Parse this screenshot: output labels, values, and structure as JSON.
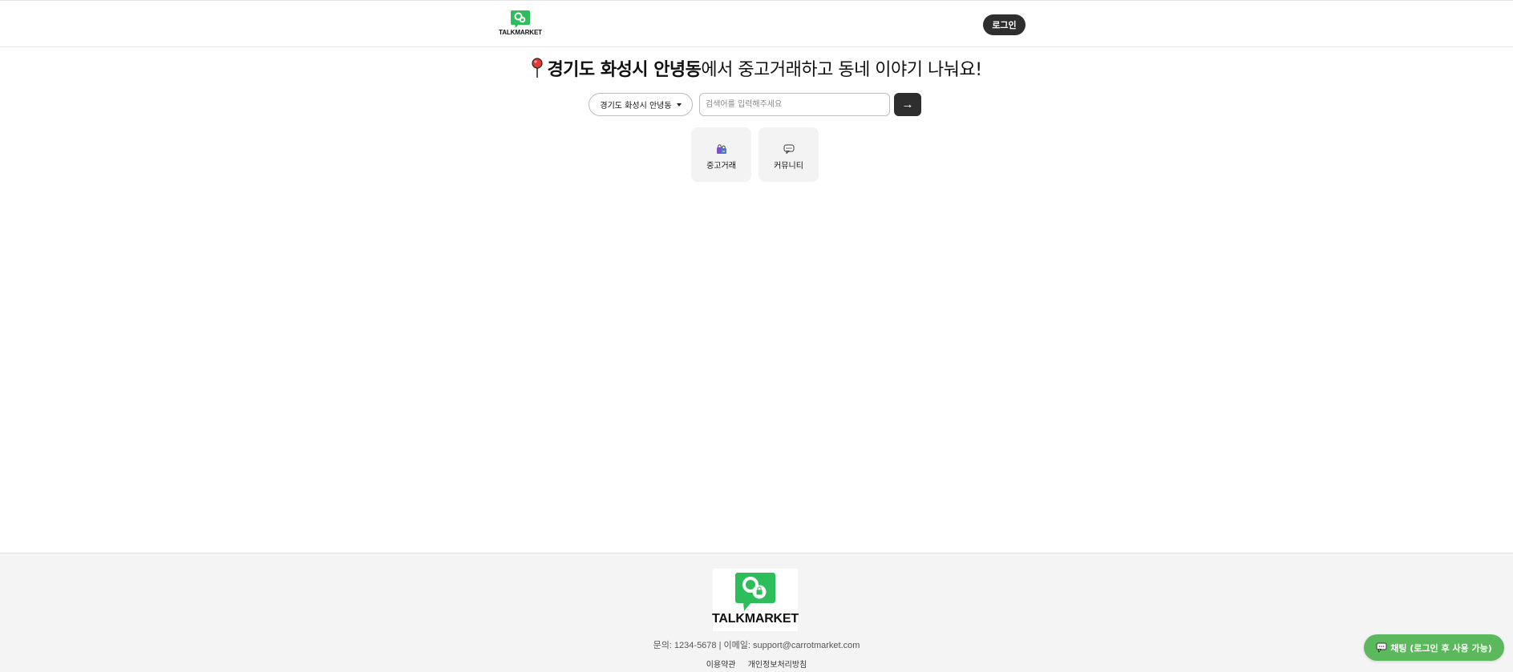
{
  "header": {
    "logo_text": "TALKMARKET",
    "login_label": "로그인"
  },
  "hero": {
    "pin_icon": "round-pushpin-icon",
    "highlight": "경기도 화성시 안녕동",
    "rest": "에서 중고거래하고 동네 이야기 나눠요!"
  },
  "search": {
    "region_value": "경기도 화성시 안녕동",
    "placeholder": "검색어를 입력해주세요",
    "submit_label": "→"
  },
  "categories": [
    {
      "icon": "shopping-bags-icon",
      "label": "중고거래"
    },
    {
      "icon": "speech-bubble-icon",
      "label": "커뮤니티"
    }
  ],
  "footer": {
    "logo_text": "TALKMARKET",
    "contact": "문의: 1234-5678 | 이메일: support@carrotmarket.com",
    "links": [
      "이용약관",
      "개인정보처리방침"
    ]
  },
  "chat_button": {
    "icon": "speech-bubble-icon",
    "label": "채팅 (로그인 후 사용 가능)"
  },
  "colors": {
    "brand_green": "#2dbd5a",
    "dark_button": "#2e2e2e",
    "chat_green": "#5cb85c"
  }
}
